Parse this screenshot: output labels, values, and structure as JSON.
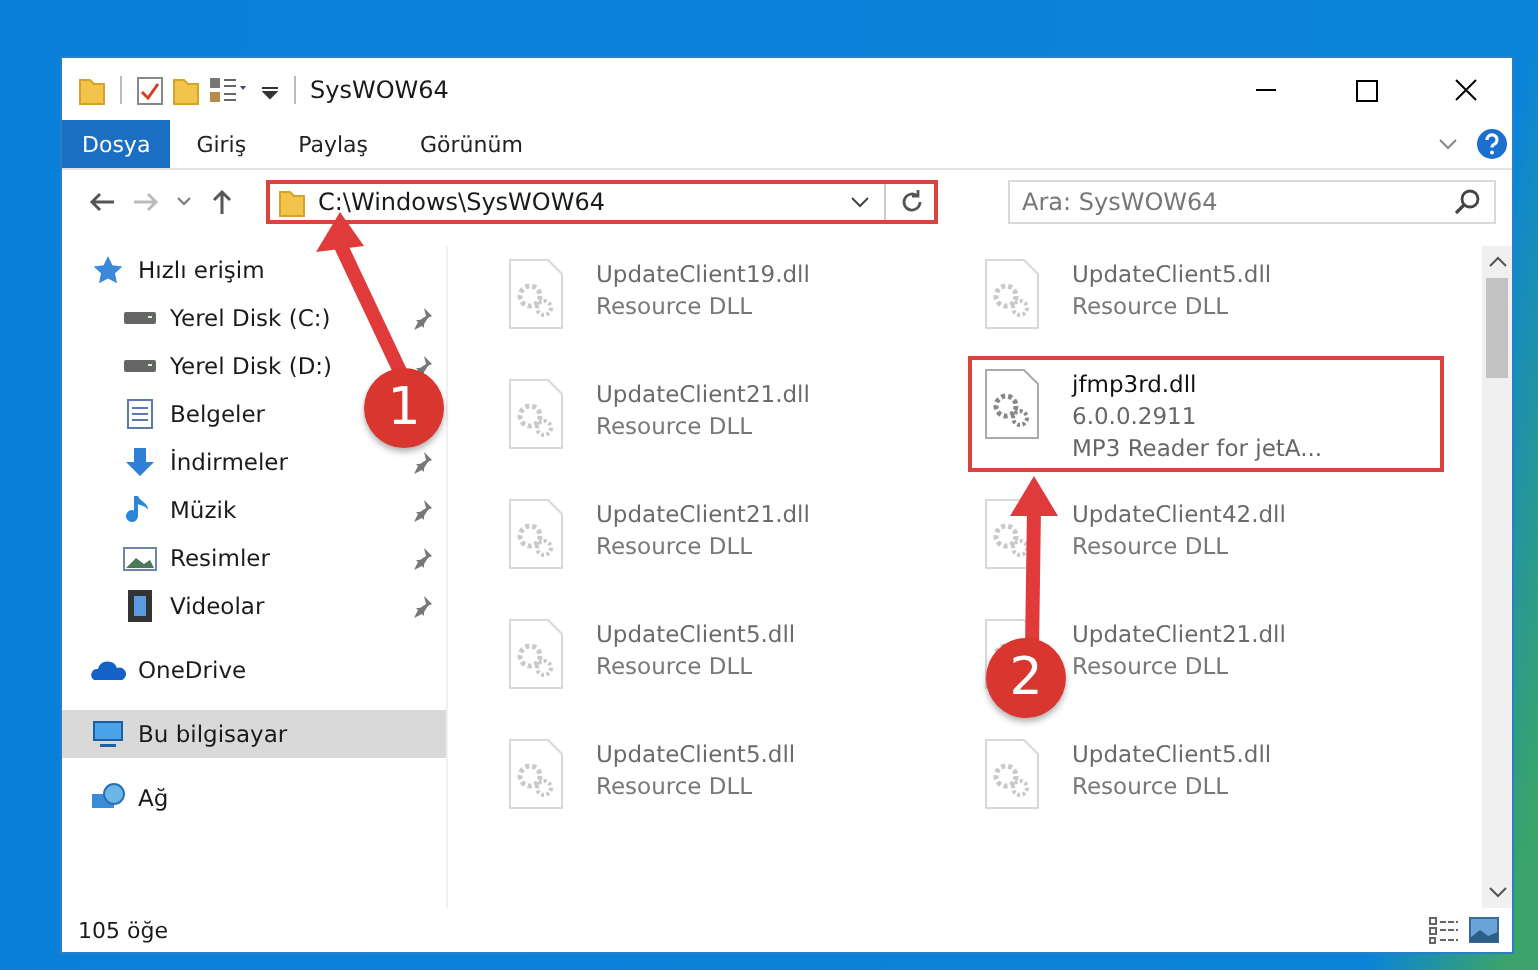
{
  "window": {
    "title": "SysWOW64"
  },
  "ribbon_tabs": [
    {
      "label": "Dosya",
      "selected": true
    },
    {
      "label": "Giriş",
      "selected": false
    },
    {
      "label": "Paylaş",
      "selected": false
    },
    {
      "label": "Görünüm",
      "selected": false
    }
  ],
  "address_bar": {
    "path": "C:\\Windows\\SysWOW64",
    "highlighted": true
  },
  "search": {
    "placeholder": "Ara: SysWOW64"
  },
  "sidebar": {
    "items": [
      {
        "label": "Hızlı erişim",
        "kind": "star",
        "selected": false,
        "children": [
          {
            "label": "Yerel Disk (C:)",
            "kind": "drive",
            "pinned": true,
            "selected": false
          },
          {
            "label": "Yerel Disk (D:)",
            "kind": "drive",
            "pinned": true,
            "selected": false
          },
          {
            "label": "Belgeler",
            "kind": "documents",
            "selected": false
          },
          {
            "label": "İndirmeler",
            "kind": "downloads",
            "pinned": true,
            "selected": false
          },
          {
            "label": "Müzik",
            "kind": "music",
            "pinned": true,
            "selected": false
          },
          {
            "label": "Resimler",
            "kind": "pictures",
            "pinned": true,
            "selected": false
          },
          {
            "label": "Videolar",
            "kind": "videos",
            "pinned": true,
            "selected": false
          }
        ]
      },
      {
        "label": "OneDrive",
        "kind": "cloud",
        "selected": false
      },
      {
        "label": "Bu bilgisayar",
        "kind": "computer",
        "selected": true
      },
      {
        "label": "Ağ",
        "kind": "network",
        "selected": false
      }
    ]
  },
  "files": [
    {
      "name": "UpdateClient19.dll",
      "lines": [
        "Resource DLL"
      ],
      "highlighted": false
    },
    {
      "name": "UpdateClient5.dll",
      "lines": [
        "Resource DLL"
      ],
      "highlighted": false
    },
    {
      "name": "UpdateClient21.dll",
      "lines": [
        "Resource DLL"
      ],
      "highlighted": false
    },
    {
      "name": "jfmp3rd.dll",
      "lines": [
        "6.0.0.2911",
        "MP3 Reader for jetA..."
      ],
      "highlighted": true
    },
    {
      "name": "UpdateClient21.dll",
      "lines": [
        "Resource DLL"
      ],
      "highlighted": false
    },
    {
      "name": "UpdateClient42.dll",
      "lines": [
        "Resource DLL"
      ],
      "highlighted": false
    },
    {
      "name": "UpdateClient5.dll",
      "lines": [
        "Resource DLL"
      ],
      "highlighted": false
    },
    {
      "name": "UpdateClient21.dll",
      "lines": [
        "Resource DLL"
      ],
      "highlighted": false
    },
    {
      "name": "UpdateClient5.dll",
      "lines": [
        "Resource DLL"
      ],
      "highlighted": false
    },
    {
      "name": "UpdateClient5.dll",
      "lines": [
        "Resource DLL"
      ],
      "highlighted": false
    }
  ],
  "annotations": [
    {
      "number": "1"
    },
    {
      "number": "2"
    }
  ],
  "status_bar": {
    "count": "105 öğe"
  }
}
